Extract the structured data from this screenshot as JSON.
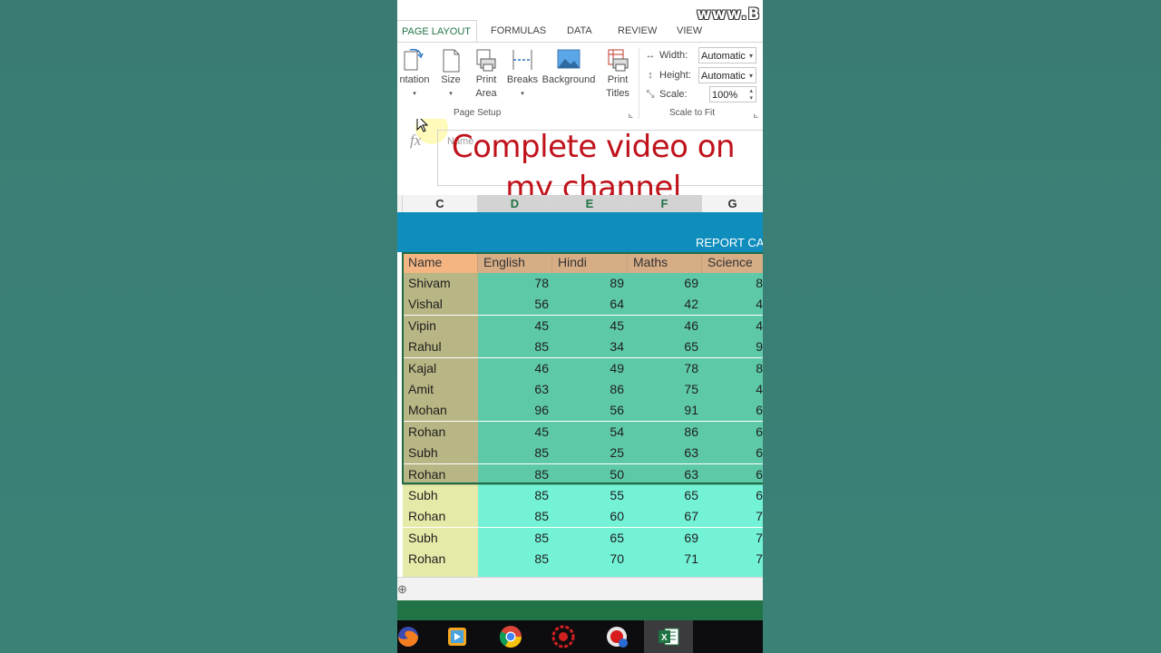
{
  "watermark": "www.B",
  "ribbon": {
    "tabs": [
      "PAGE LAYOUT",
      "FORMULAS",
      "DATA",
      "REVIEW",
      "VIEW"
    ],
    "page_setup": {
      "orientation": "ntation",
      "size": "Size",
      "print_area": [
        "Print",
        "Area"
      ],
      "breaks": "Breaks",
      "background": "Background",
      "print_titles": [
        "Print",
        "Titles"
      ],
      "group_label": "Page Setup"
    },
    "scale_to_fit": {
      "width_label": "Width:",
      "width_value": "Automatic",
      "height_label": "Height:",
      "height_value": "Automatic",
      "scale_label": "Scale:",
      "scale_value": "100%",
      "group_label": "Scale to Fit"
    }
  },
  "formula_bar": {
    "fx": "fx",
    "name_placeholder": "Name"
  },
  "overlay_text": [
    "Complete video on",
    "my channel"
  ],
  "columns": [
    "C",
    "D",
    "E",
    "F",
    "G"
  ],
  "sheet": {
    "title": "REPORT CA",
    "headers": [
      "Name",
      "English",
      "Hindi",
      "Maths",
      "Science"
    ],
    "rows": [
      [
        "Shivam",
        "78",
        "89",
        "69",
        "8"
      ],
      [
        "Vishal",
        "56",
        "64",
        "42",
        "4"
      ],
      [
        "Vipin",
        "45",
        "45",
        "46",
        "4"
      ],
      [
        "Rahul",
        "85",
        "34",
        "65",
        "9"
      ],
      [
        "Kajal",
        "46",
        "49",
        "78",
        "8"
      ],
      [
        "Amit",
        "63",
        "86",
        "75",
        "4"
      ],
      [
        "Mohan",
        "96",
        "56",
        "91",
        "6"
      ],
      [
        "Rohan",
        "45",
        "54",
        "86",
        "6"
      ],
      [
        "Subh",
        "85",
        "25",
        "63",
        "6"
      ],
      [
        "Rohan",
        "85",
        "50",
        "63",
        "6"
      ],
      [
        "Subh",
        "85",
        "55",
        "65",
        "6"
      ],
      [
        "Rohan",
        "85",
        "60",
        "67",
        "7"
      ],
      [
        "Subh",
        "85",
        "65",
        "69",
        "7"
      ],
      [
        "Rohan",
        "85",
        "70",
        "71",
        "7"
      ]
    ]
  },
  "colors": {
    "excel_green": "#217346",
    "title_blue": "#0f8dbd",
    "header_orange": "#f4b583",
    "header_tan": "#d7ad86",
    "name_selected": "#b8b684",
    "name_normal": "#e6eaa8",
    "data_selected": "#5ec9a9",
    "data_normal": "#74f2d6",
    "overlay_red": "#c0121b"
  },
  "taskbar_icons": [
    "firefox-icon",
    "media-player-icon",
    "chrome-icon",
    "settings-app-icon",
    "screen-recorder-icon",
    "excel-icon"
  ]
}
